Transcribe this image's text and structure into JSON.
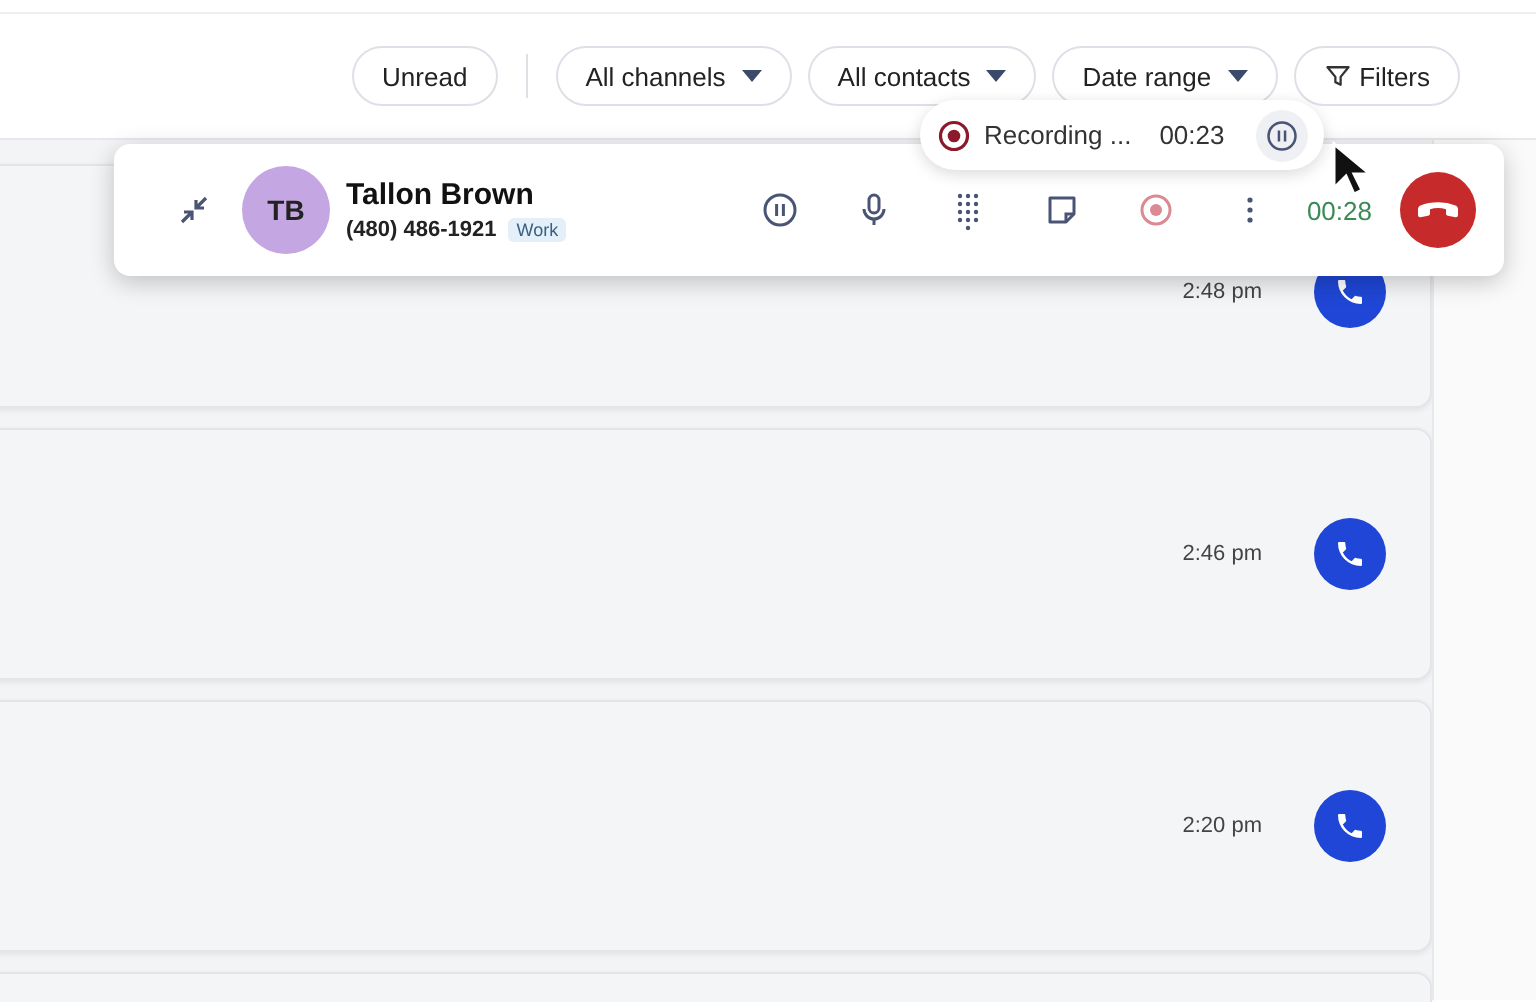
{
  "filters": [
    {
      "label": "Unread",
      "kind": "toggle"
    },
    {
      "label": "All channels",
      "kind": "dropdown"
    },
    {
      "label": "All contacts",
      "kind": "dropdown"
    },
    {
      "label": "Date range",
      "kind": "dropdown"
    },
    {
      "label": "Filters",
      "kind": "filter"
    }
  ],
  "conversations": [
    {
      "time": "2:48 pm"
    },
    {
      "time": "2:46 pm"
    },
    {
      "time": "2:20 pm"
    }
  ],
  "call": {
    "initials": "TB",
    "name": "Tallon Brown",
    "phone": "(480) 486-1921",
    "tag": "Work",
    "timer": "00:28",
    "recording": {
      "label": "Recording ...",
      "time": "00:23"
    }
  }
}
